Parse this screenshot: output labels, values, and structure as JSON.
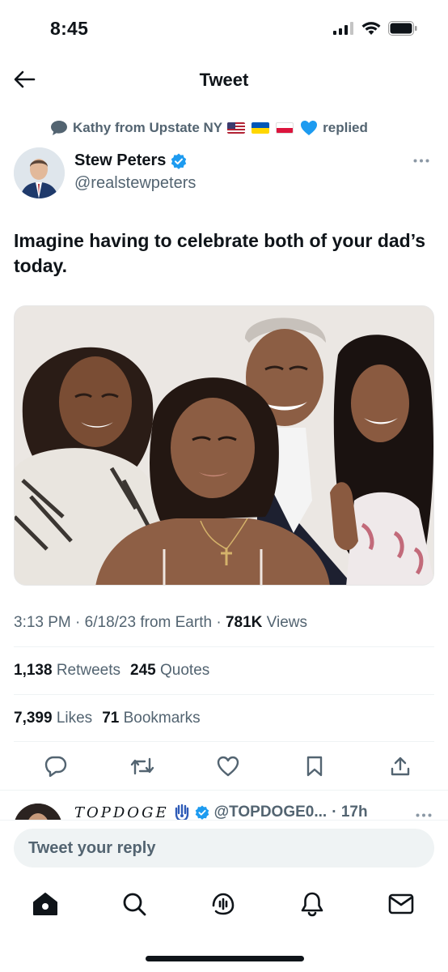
{
  "status_bar": {
    "time": "8:45"
  },
  "header": {
    "title": "Tweet"
  },
  "context": {
    "name": "Kathy from Upstate NY",
    "action": "replied",
    "flags": [
      "flag-us",
      "flag-ukraine",
      "flag-poland",
      "blue-heart"
    ]
  },
  "tweet": {
    "author_name": "Stew Peters",
    "author_handle": "@realstewpeters",
    "verified": true,
    "text": "Imagine having to celebrate both of your dad’s today.",
    "time": "3:13 PM",
    "date": "6/18/23",
    "source": "from Earth",
    "views_count": "781K",
    "views_label": "Views",
    "retweets_count": "1,138",
    "retweets_label": "Retweets",
    "quotes_count": "245",
    "quotes_label": "Quotes",
    "likes_count": "7,399",
    "likes_label": "Likes",
    "bookmarks_count": "71",
    "bookmarks_label": "Bookmarks"
  },
  "next_reply": {
    "name": "TOPDOGE",
    "handle": "@TOPDOGE0...",
    "time": "17h"
  },
  "reply_box": {
    "placeholder": "Tweet your reply"
  },
  "tabs": [
    "home",
    "search",
    "spaces",
    "notifications",
    "messages"
  ],
  "colors": {
    "accent": "#1d9bf0",
    "text": "#0f1419",
    "secondary": "#536471",
    "divider": "#eff3f4"
  }
}
